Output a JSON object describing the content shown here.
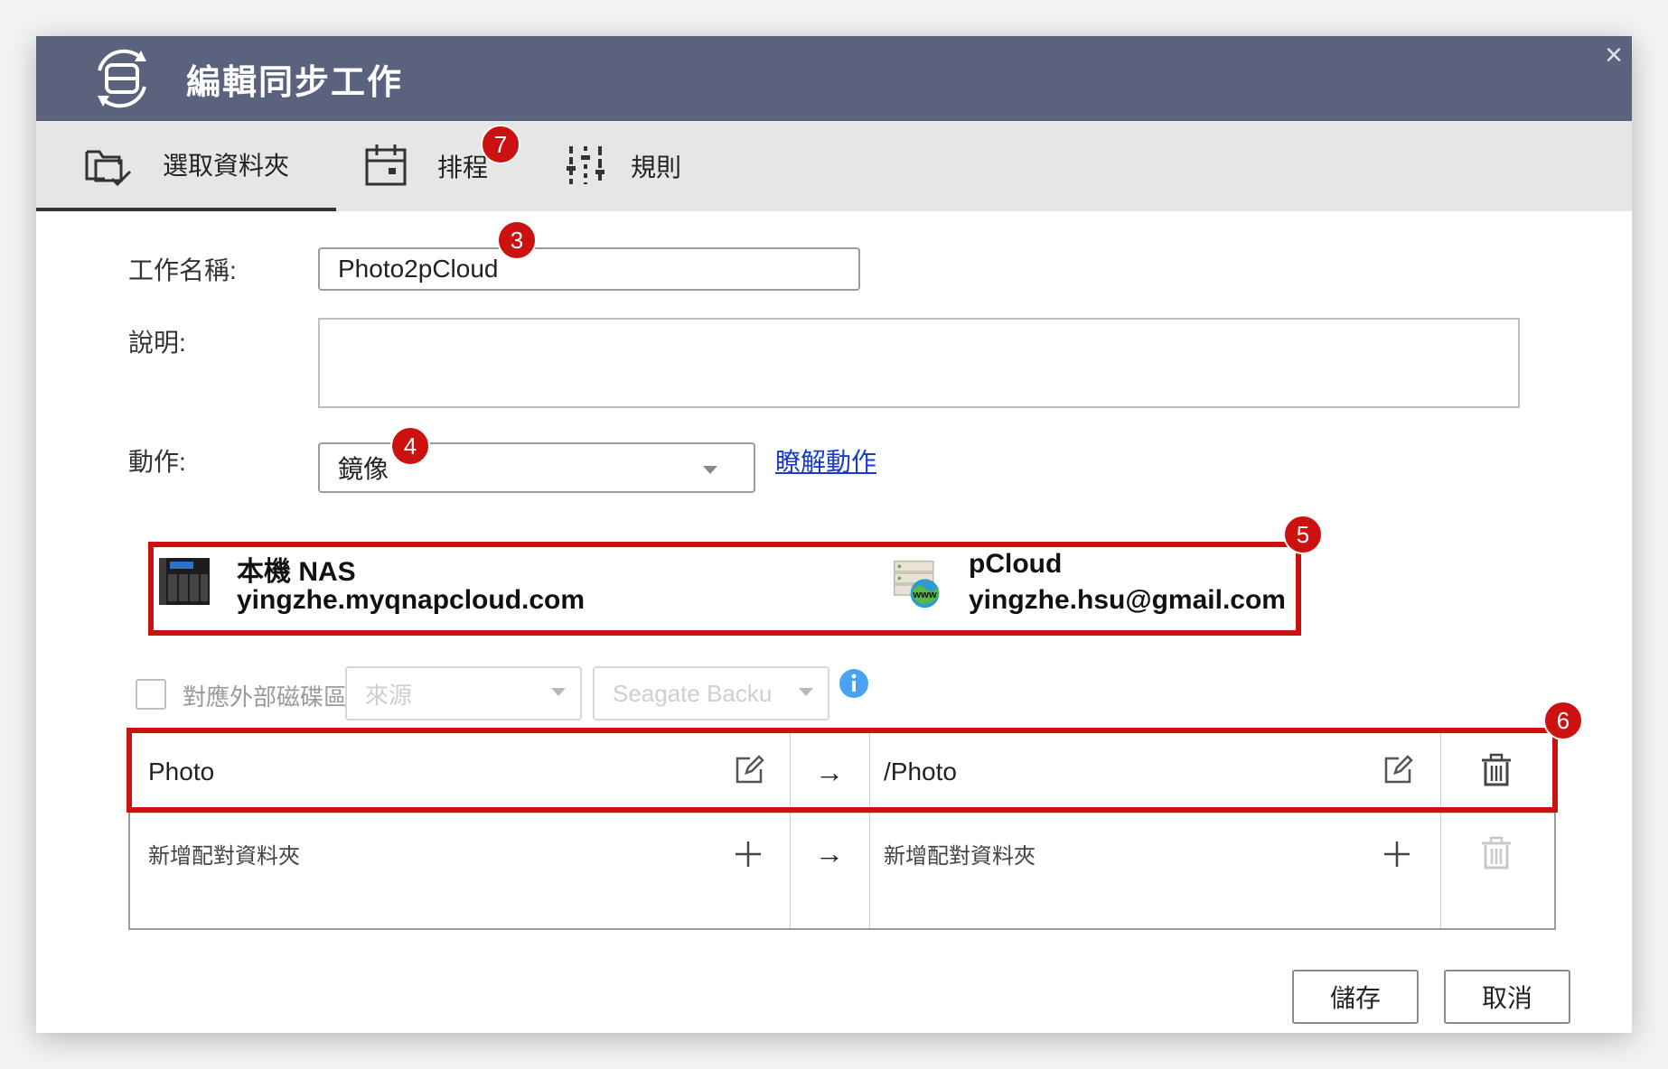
{
  "window": {
    "title": "編輯同步工作",
    "close_glyph": "×"
  },
  "tabs": [
    {
      "label": "選取資料夾",
      "icon": "folder-sync-icon",
      "active": true
    },
    {
      "label": "排程",
      "icon": "calendar-icon",
      "active": false
    },
    {
      "label": "規則",
      "icon": "sliders-icon",
      "active": false
    }
  ],
  "form": {
    "job_name_label": "工作名稱:",
    "job_name_value": "Photo2pCloud",
    "description_label": "說明:",
    "description_value": "",
    "action_label": "動作:",
    "action_value": "鏡像",
    "learn_link": "瞭解動作"
  },
  "devices": {
    "local": {
      "name": "本機 NAS",
      "address": "yingzhe.myqnapcloud.com",
      "icon": "nas-icon"
    },
    "remote": {
      "name": "pCloud",
      "address": "yingzhe.hsu@gmail.com",
      "icon": "web-server-icon"
    }
  },
  "external": {
    "label": "對應外部磁碟區",
    "source_placeholder": "來源",
    "drive_value": "Seagate Backu",
    "checked": false
  },
  "mappings": [
    {
      "local": "Photo",
      "remote": "/Photo",
      "arrow": "→"
    }
  ],
  "add_row": {
    "local": "新增配對資料夾",
    "remote": "新增配對資料夾",
    "arrow": "→"
  },
  "buttons": {
    "save": "儲存",
    "cancel": "取消"
  },
  "annotations": [
    "3",
    "4",
    "5",
    "6",
    "7"
  ],
  "colors": {
    "titlebar": "#5a627e",
    "annotation": "#cc1111",
    "link": "#1a3dc9"
  }
}
